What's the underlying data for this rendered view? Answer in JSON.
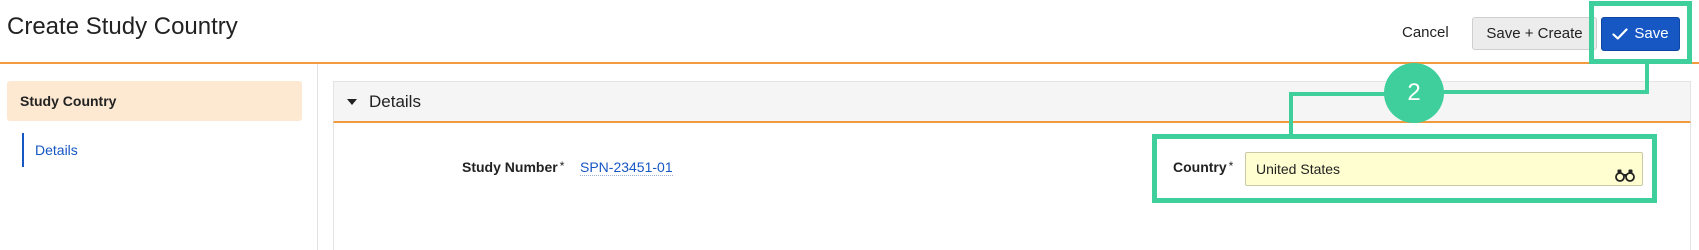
{
  "header": {
    "title": "Create Study Country",
    "cancel_label": "Cancel",
    "save_create_label": "Save + Create",
    "save_label": "Save"
  },
  "annotation": {
    "step_number": "2"
  },
  "sidebar": {
    "items": [
      {
        "label": "Study Country",
        "active": true
      },
      {
        "label": "Details",
        "active": false
      }
    ]
  },
  "section": {
    "title": "Details",
    "fields": {
      "study_number": {
        "label": "Study Number",
        "required_mark": "*",
        "value": "SPN-23451-01"
      },
      "country": {
        "label": "Country",
        "required_mark": "*",
        "value": "United States"
      }
    }
  },
  "icons": {
    "save": "check-icon",
    "collapse": "caret-down-icon",
    "lookup": "binoculars-icon"
  },
  "colors": {
    "accent_orange": "#f19a3e",
    "primary_blue": "#1657c4",
    "annotation_green": "#3ecf9c",
    "input_highlight": "#fffed0",
    "active_nav_bg": "#fde9d2"
  }
}
